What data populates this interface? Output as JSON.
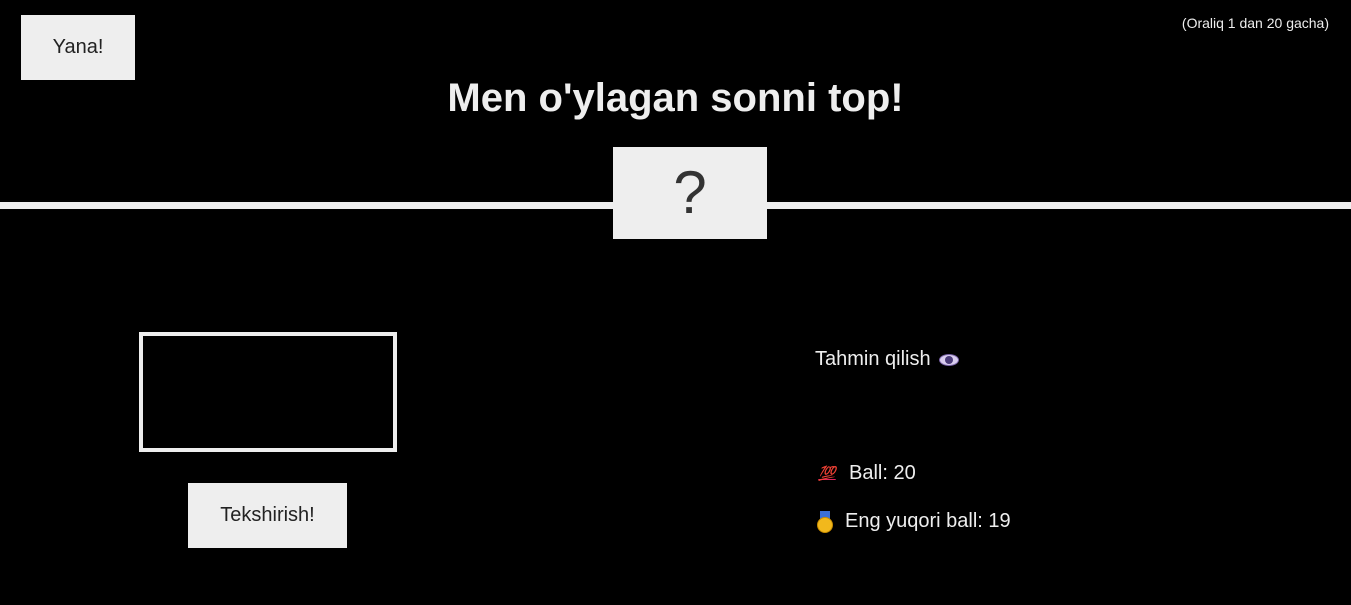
{
  "header": {
    "again_label": "Yana!",
    "range_note": "(Oraliq 1 dan 20 gacha)",
    "title": "Men o'ylagan sonni top!"
  },
  "secret": {
    "display": "?"
  },
  "guess": {
    "value": "",
    "check_label": "Tekshirish!"
  },
  "status": {
    "message": "Tahmin qilish",
    "message_icon": "eye-icon",
    "score_label": "Ball: 20",
    "score_icon": "hundred-points-icon",
    "highscore_label": "Eng yuqori ball: 19",
    "highscore_icon": "medal-icon"
  },
  "colors": {
    "background": "#000000",
    "foreground": "#eeeeee",
    "button_text": "#222222"
  }
}
